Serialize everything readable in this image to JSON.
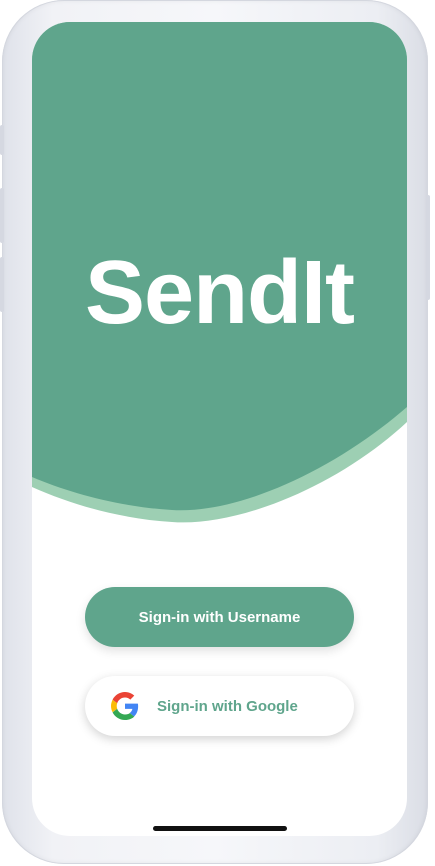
{
  "app": {
    "title": "SendIt"
  },
  "buttons": {
    "username_label": "Sign-in with Username",
    "google_label": "Sign-in with Google"
  },
  "colors": {
    "brand_green": "#5fa58c",
    "accent_light_green": "#9dcfb3",
    "background": "#ffffff"
  },
  "icons": {
    "google": "google-g-icon"
  }
}
